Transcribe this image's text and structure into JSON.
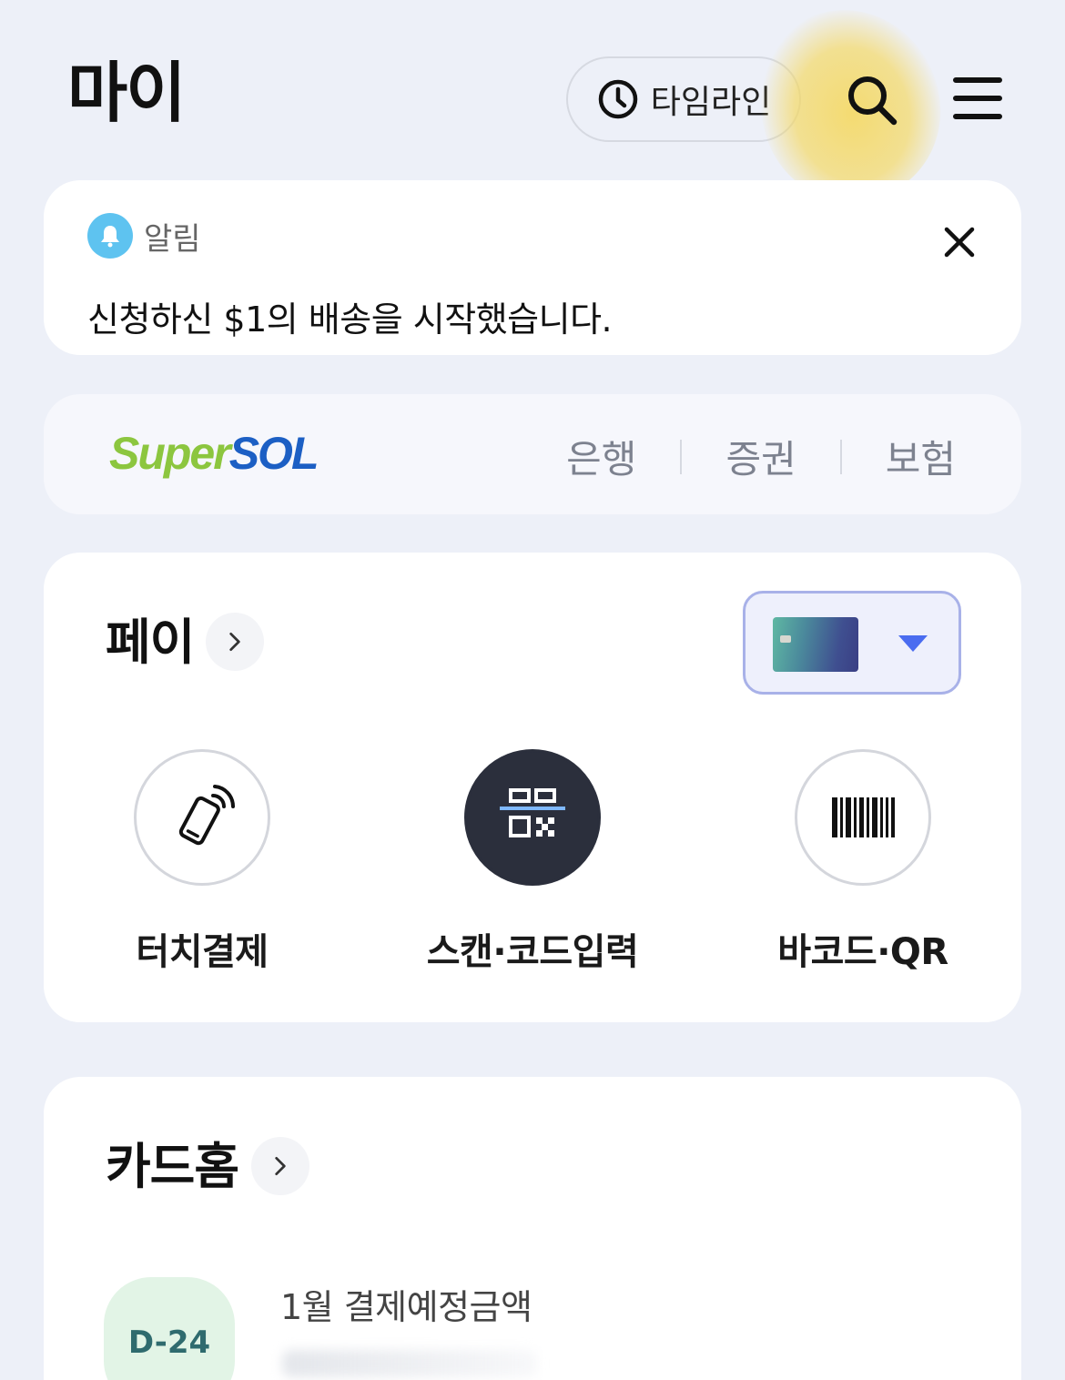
{
  "header": {
    "title": "마이",
    "timeline_label": "타임라인",
    "icons": [
      "clock-icon",
      "search-icon",
      "menu-icon"
    ]
  },
  "notice": {
    "label": "알림",
    "message": "신청하신 $1의 배송을 시작했습니다.",
    "icons": [
      "bell-icon",
      "close-icon"
    ]
  },
  "supersol": {
    "logo_super": "Super",
    "logo_sol": "SOL",
    "links": [
      "은행",
      "증권",
      "보험"
    ],
    "colors": {
      "super": "#8cc63f",
      "sol": "#1c5fc4"
    }
  },
  "pay": {
    "title": "페이",
    "actions": [
      {
        "label": "터치결제",
        "icon": "phone-tap-icon"
      },
      {
        "label": "스캔·코드입력",
        "icon": "qr-scan-icon"
      },
      {
        "label": "바코드·QR",
        "icon": "barcode-icon"
      }
    ]
  },
  "card_home": {
    "title": "카드홈",
    "dday": "D-24",
    "due_label": "1월 결제예정금액"
  },
  "colors": {
    "background": "#edf0f8",
    "accent": "#4a6cf0",
    "dday_bg": "#e2f4e6"
  }
}
